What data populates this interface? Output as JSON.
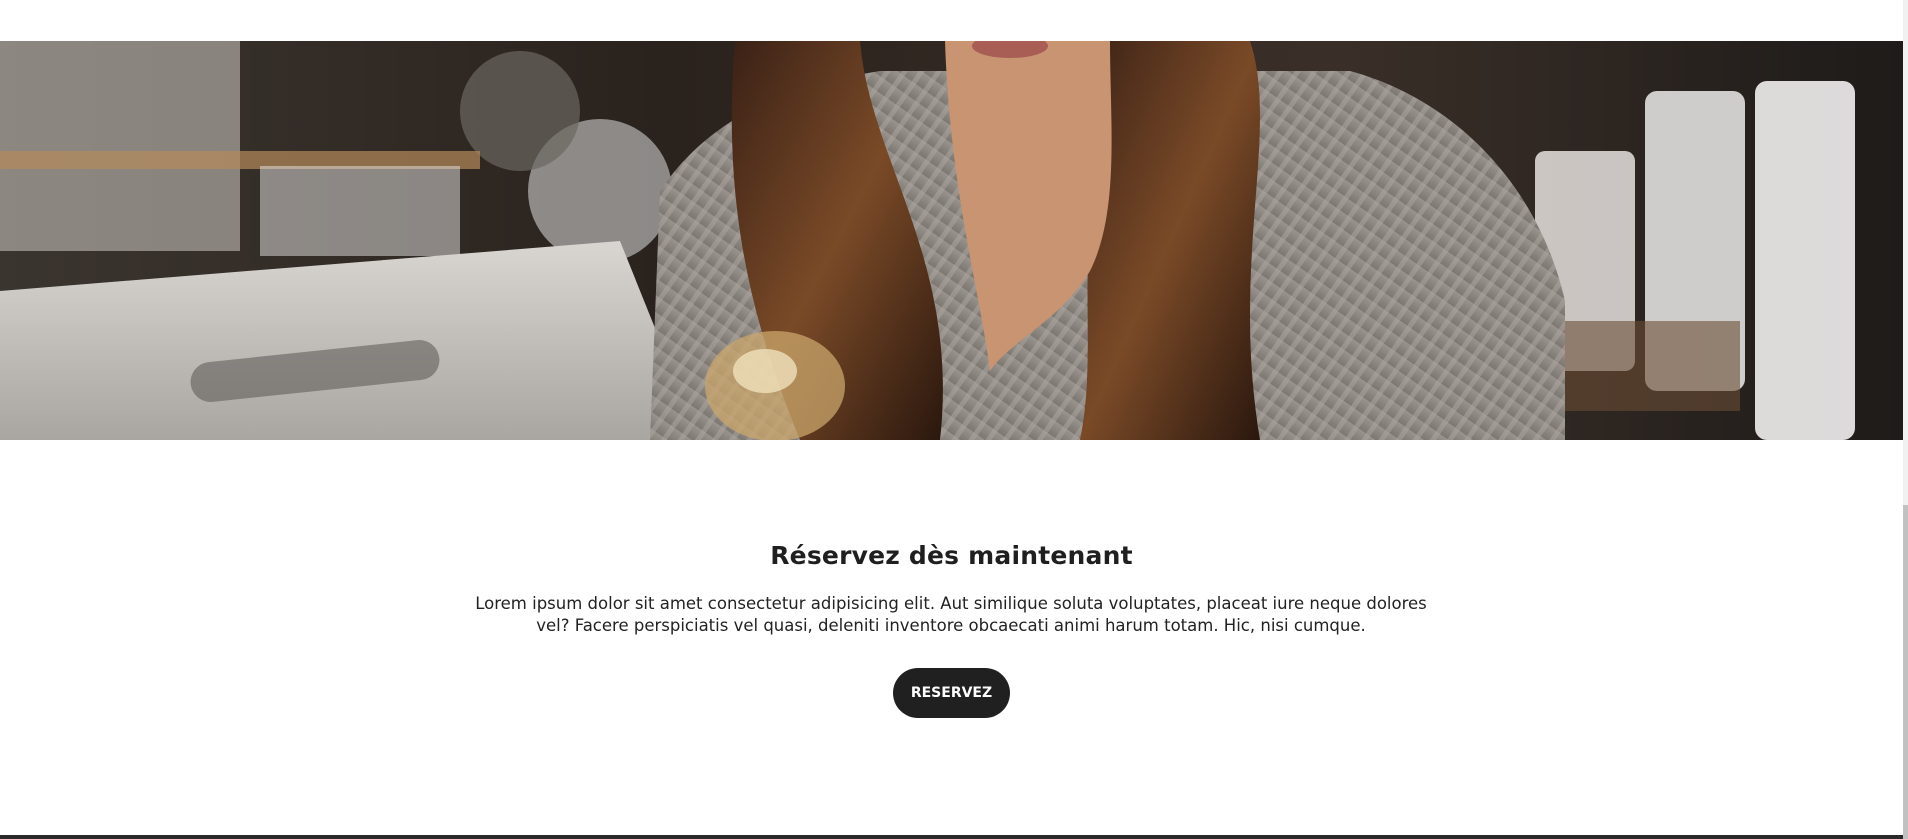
{
  "hero": {
    "image_subject": "woman with long hair in grey sweater pouring at a cafe counter"
  },
  "cta": {
    "title": "Réservez dès maintenant",
    "text": "Lorem ipsum dolor sit amet consectetur adipisicing elit. Aut similique soluta voluptates, placeat iure neque dolores vel? Facere perspiciatis vel quasi, deleniti inventore obcaecati animi harum totam. Hic, nisi cumque.",
    "button_label": "RESERVEZ"
  },
  "colors": {
    "button_bg": "#202020",
    "button_text": "#ffffff",
    "title": "#1f1f1f",
    "text": "#222222"
  }
}
